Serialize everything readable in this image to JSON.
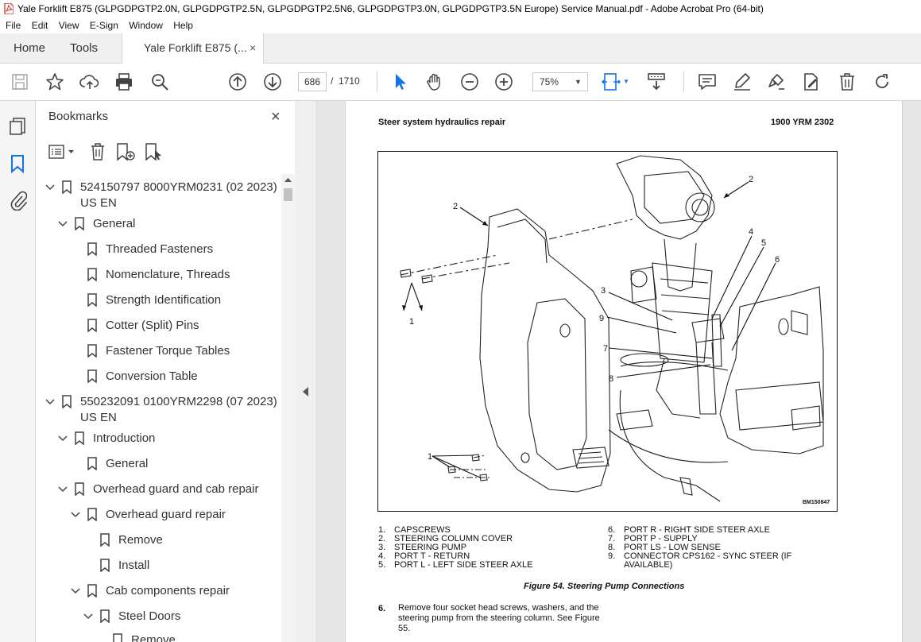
{
  "window": {
    "title": "Yale Forklift E875 (GLPGDPGTP2.0N, GLPGDPGTP2.5N, GLPGDPGTP2.5N6, GLPGDPGTP3.0N, GLPGDPGTP3.5N Europe) Service Manual.pdf - Adobe Acrobat Pro (64-bit)"
  },
  "menu": [
    "File",
    "Edit",
    "View",
    "E-Sign",
    "Window",
    "Help"
  ],
  "tabs": {
    "home": "Home",
    "tools": "Tools",
    "document": "Yale Forklift E875 (...",
    "close": "×"
  },
  "toolbar": {
    "page_current": "686",
    "page_separator": "/",
    "page_total": "1710",
    "zoom": "75%"
  },
  "panel": {
    "title": "Bookmarks",
    "close": "×"
  },
  "bookmarks": [
    {
      "label": "524150797 8000YRM0231 (02 2023)",
      "label2": "US EN"
    },
    {
      "label": "General"
    },
    {
      "label": "Threaded Fasteners"
    },
    {
      "label": "Nomenclature, Threads"
    },
    {
      "label": "Strength Identification"
    },
    {
      "label": "Cotter (Split) Pins"
    },
    {
      "label": "Fastener Torque Tables"
    },
    {
      "label": "Conversion Table"
    },
    {
      "label": "550232091 0100YRM2298 (07 2023)",
      "label2": "US EN"
    },
    {
      "label": "Introduction"
    },
    {
      "label": "General"
    },
    {
      "label": "Overhead guard and cab repair"
    },
    {
      "label": "Overhead guard repair"
    },
    {
      "label": "Remove"
    },
    {
      "label": "Install"
    },
    {
      "label": "Cab components repair"
    },
    {
      "label": "Steel Doors"
    },
    {
      "label": "Remove"
    }
  ],
  "document": {
    "header_left": "Steer system hydraulics repair",
    "header_right": "1900 YRM 2302",
    "figure_id": "BM150847",
    "callouts": [
      "2",
      "2",
      "1",
      "3",
      "4",
      "5",
      "6",
      "9",
      "7",
      "8",
      "1"
    ],
    "legend_left": [
      {
        "num": "1.",
        "text": "CAPSCREWS"
      },
      {
        "num": "2.",
        "text": "STEERING COLUMN COVER"
      },
      {
        "num": "3.",
        "text": "STEERING PUMP"
      },
      {
        "num": "4.",
        "text": "PORT T - RETURN"
      },
      {
        "num": "5.",
        "text": "PORT L - LEFT SIDE STEER AXLE"
      }
    ],
    "legend_right": [
      {
        "num": "6.",
        "text": "PORT R - RIGHT SIDE STEER AXLE"
      },
      {
        "num": "7.",
        "text": "PORT P - SUPPLY"
      },
      {
        "num": "8.",
        "text": "PORT LS - LOW SENSE"
      },
      {
        "num": "9.",
        "text": "CONNECTOR CPS162 - SYNC STEER (IF"
      },
      {
        "num": "",
        "text": "AVAILABLE)"
      }
    ],
    "caption": "Figure 54. Steering Pump Connections",
    "step_number": "6.",
    "step_text": "Remove four socket head screws, washers, and the steering pump from the steering column. See Figure 55."
  }
}
